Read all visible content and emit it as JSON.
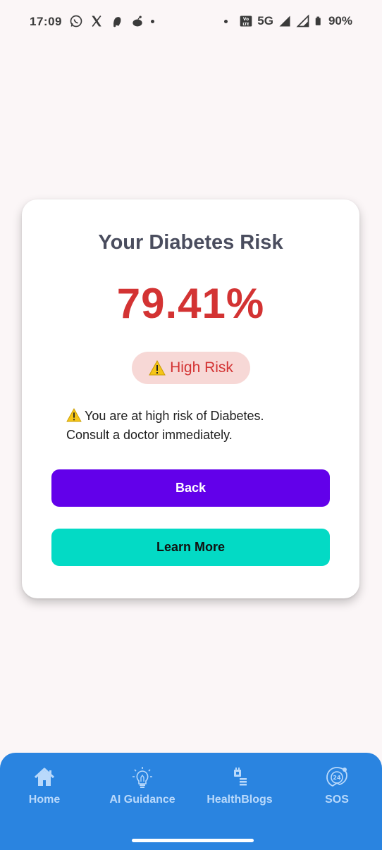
{
  "status_bar": {
    "time": "17:09",
    "left_icons": [
      "whatsapp-icon",
      "x-icon",
      "notification-icon",
      "app-icon",
      "dot"
    ],
    "right_icons": [
      "dot",
      "volte-icon",
      "signal-icon",
      "signal-icon",
      "battery-icon"
    ],
    "network": "5G",
    "battery": "90%"
  },
  "result": {
    "title": "Your Diabetes Risk",
    "percentage": "79.41%",
    "badge_label": "High Risk",
    "message_line1": "You are at high risk of Diabetes.",
    "message_line2": "Consult a doctor immediately.",
    "accent_color": "#d33333"
  },
  "buttons": {
    "back": "Back",
    "learn_more": "Learn More"
  },
  "bottom_nav": {
    "items": [
      {
        "label": "Home",
        "icon": "home-icon"
      },
      {
        "label": "AI Guidance",
        "icon": "lightbulb-icon"
      },
      {
        "label": "HealthBlogs",
        "icon": "blog-icon"
      },
      {
        "label": "SOS",
        "icon": "sos-24-icon"
      }
    ]
  }
}
